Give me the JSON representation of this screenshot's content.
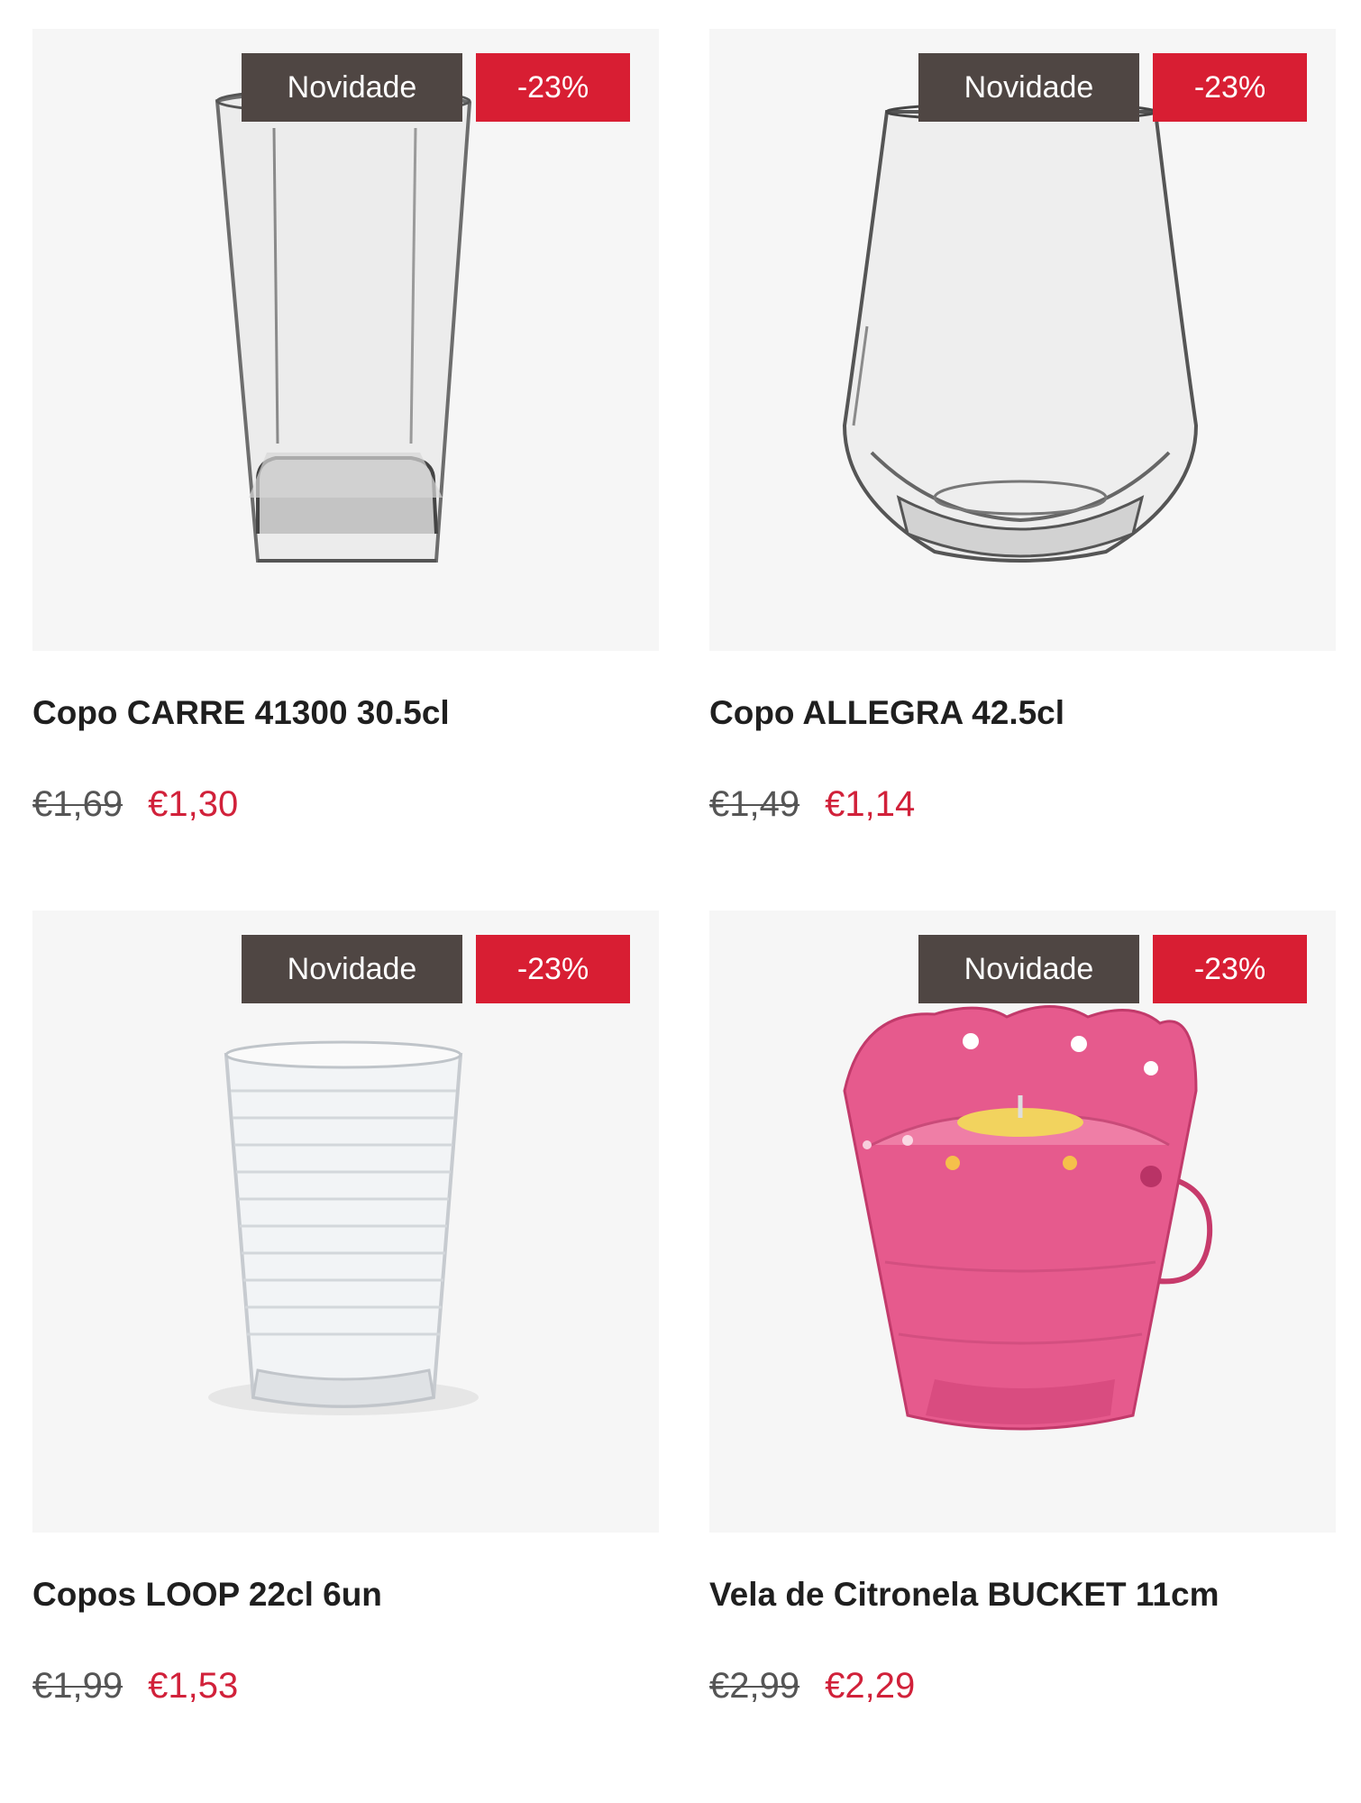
{
  "badge_new_label": "Novidade",
  "colors": {
    "badge_new": "#4f4643",
    "badge_discount": "#d81e33",
    "sale_price": "#d1213a"
  },
  "products": [
    {
      "title": "Copo CARRE 41300 30.5cl",
      "discount": "-23%",
      "old_price": "€1,69",
      "price": "€1,30",
      "image": "tall-square-glass"
    },
    {
      "title": "Copo ALLEGRA 42.5cl",
      "discount": "-23%",
      "old_price": "€1,49",
      "price": "€1,14",
      "image": "stemless-wine-glass"
    },
    {
      "title": "Copos LOOP 22cl 6un",
      "discount": "-23%",
      "old_price": "€1,99",
      "price": "€1,53",
      "image": "ribbed-tumbler-glass"
    },
    {
      "title": "Vela de Citronela BUCKET 11cm",
      "discount": "-23%",
      "old_price": "€2,99",
      "price": "€2,29",
      "image": "pink-bucket-candle"
    }
  ]
}
